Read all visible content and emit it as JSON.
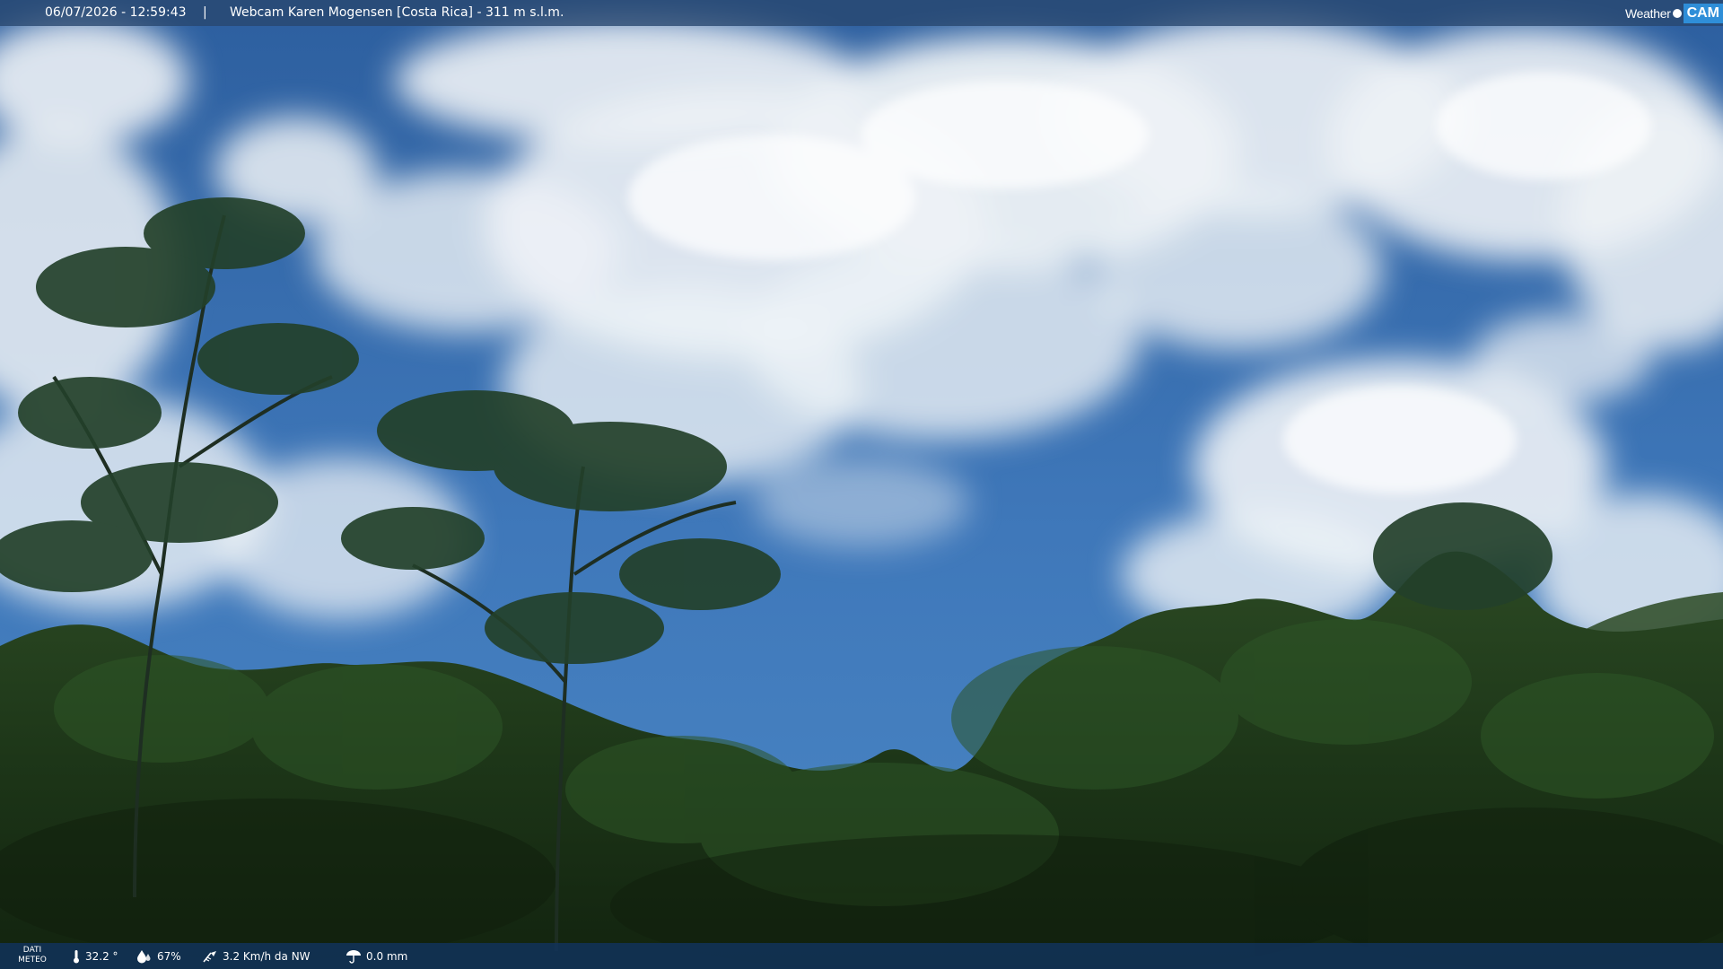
{
  "overlay": {
    "timestamp": "06/07/2026 - 12:59:43",
    "separator": "|",
    "camera_title": "Webcam Karen Mogensen [Costa Rica] - 311 m s.l.m."
  },
  "logo": {
    "weather_text": "Weather",
    "cam_text": "CAM"
  },
  "meteo": {
    "label_line1": "DATI",
    "label_line2": "METEO",
    "temperature": "32.2 °",
    "humidity": "67%",
    "wind": "3.2 Km/h da NW",
    "rain": "0.0 mm",
    "icons": [
      "thermometer-icon",
      "humidity-icon",
      "wind-icon",
      "rain-icon"
    ]
  },
  "colors": {
    "sky": "#3b6fb0",
    "cloud": "#eef2f6",
    "forest": "#1f3a1c",
    "bar": "#1b3b66",
    "logo_accent": "#2f8ed8"
  }
}
